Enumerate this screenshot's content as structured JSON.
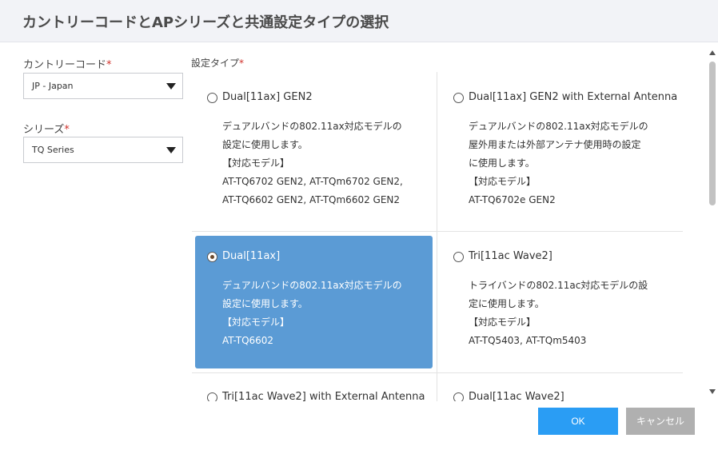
{
  "dialog": {
    "title": "カントリーコードとAPシリーズと共通設定タイプの選択"
  },
  "country": {
    "label": "カントリーコード",
    "required_mark": "*",
    "value": "JP - Japan"
  },
  "series": {
    "label": "シリーズ",
    "required_mark": "*",
    "value": "TQ Series"
  },
  "settings_type": {
    "label": "設定タイプ",
    "required_mark": "*",
    "options": [
      {
        "title": "Dual[11ax] GEN2",
        "lines": [
          "デュアルバンドの802.11ax対応モデルの",
          "設定に使用します。",
          "【対応モデル】",
          "AT-TQ6702 GEN2, AT-TQm6702 GEN2,",
          "AT-TQ6602 GEN2, AT-TQm6602 GEN2"
        ],
        "selected": false
      },
      {
        "title": "Dual[11ax] GEN2 with External Antenna",
        "lines": [
          "デュアルバンドの802.11ax対応モデルの",
          "屋外用または外部アンテナ使用時の設定",
          "に使用します。",
          "【対応モデル】",
          "AT-TQ6702e GEN2"
        ],
        "selected": false
      },
      {
        "title": "Dual[11ax]",
        "lines": [
          "デュアルバンドの802.11ax対応モデルの",
          "設定に使用します。",
          "【対応モデル】",
          "AT-TQ6602"
        ],
        "selected": true
      },
      {
        "title": "Tri[11ac Wave2]",
        "lines": [
          "トライバンドの802.11ac対応モデルの設",
          "定に使用します。",
          "【対応モデル】",
          "AT-TQ5403, AT-TQm5403"
        ],
        "selected": false
      },
      {
        "title": "Tri[11ac Wave2] with External Antenna",
        "lines": [],
        "selected": false
      },
      {
        "title": "Dual[11ac Wave2]",
        "lines": [],
        "selected": false
      }
    ]
  },
  "buttons": {
    "ok": "OK",
    "cancel": "キャンセル"
  },
  "colors": {
    "selected_bg": "#5b9bd5",
    "ok_bg": "#2a9df4",
    "cancel_bg": "#b0b0b0",
    "required": "#d0302a"
  }
}
